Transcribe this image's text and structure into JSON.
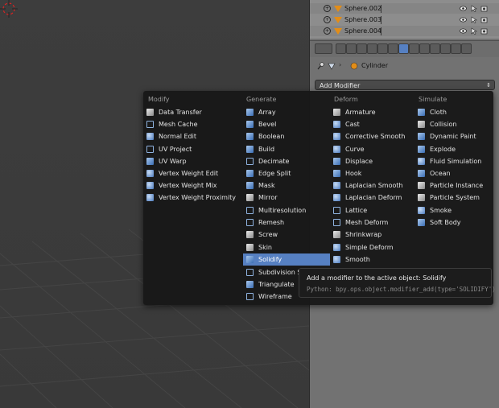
{
  "outliner": {
    "rows": [
      "Sphere.002",
      "Sphere.003",
      "Sphere.004"
    ]
  },
  "context": {
    "object_name": "Cylinder"
  },
  "add_modifier": {
    "label": "Add Modifier",
    "arrows": "⇕"
  },
  "menu": {
    "modify": {
      "heading": "Modify",
      "items": [
        "Data Transfer",
        "Mesh Cache",
        "Normal Edit",
        "UV Project",
        "UV Warp",
        "Vertex Weight Edit",
        "Vertex Weight Mix",
        "Vertex Weight Proximity"
      ]
    },
    "generate": {
      "heading": "Generate",
      "items": [
        "Array",
        "Bevel",
        "Boolean",
        "Build",
        "Decimate",
        "Edge Split",
        "Mask",
        "Mirror",
        "Multiresolution",
        "Remesh",
        "Screw",
        "Skin",
        "Solidify",
        "Subdivision Su",
        "Triangulate",
        "Wireframe"
      ]
    },
    "deform": {
      "heading": "Deform",
      "items": [
        "Armature",
        "Cast",
        "Corrective Smooth",
        "Curve",
        "Displace",
        "Hook",
        "Laplacian Smooth",
        "Laplacian Deform",
        "Lattice",
        "Mesh Deform",
        "Shrinkwrap",
        "Simple Deform",
        "Smooth"
      ]
    },
    "simulate": {
      "heading": "Simulate",
      "items": [
        "Cloth",
        "Collision",
        "Dynamic Paint",
        "Explode",
        "Fluid Simulation",
        "Ocean",
        "Particle Instance",
        "Particle System",
        "Smoke",
        "Soft Body"
      ]
    },
    "highlighted": "Solidify"
  },
  "tooltip": {
    "line1": "Add a modifier to the active object:  Solidify",
    "line2": "Python: bpy.ops.object.modifier_add(type='SOLIDIFY')"
  },
  "colors": {
    "highlight": "#5680c2",
    "menu_bg": "#181818",
    "object_orange": "#e28d18"
  }
}
